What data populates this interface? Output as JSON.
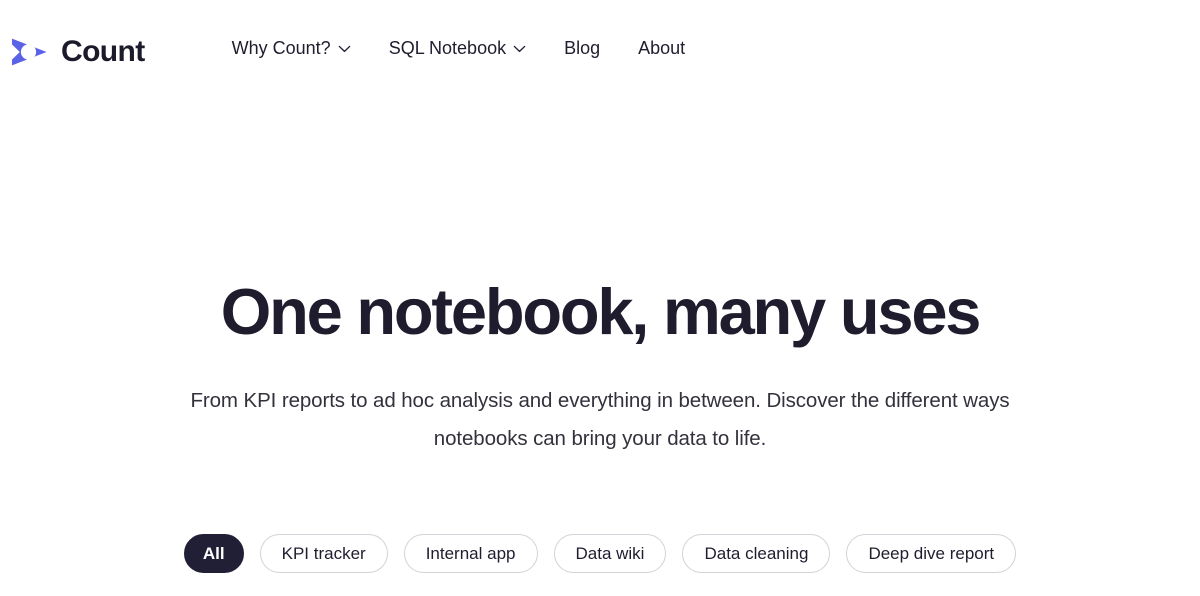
{
  "header": {
    "brand": {
      "name": "Count",
      "logo_icon": "count-triangle-logo-icon",
      "logo_color": "#5a62e8"
    },
    "nav": [
      {
        "label": "Why Count?",
        "has_dropdown": true,
        "icon": "chevron-down-icon"
      },
      {
        "label": "SQL Notebook",
        "has_dropdown": true,
        "icon": "chevron-down-icon"
      },
      {
        "label": "Blog",
        "has_dropdown": false,
        "icon": ""
      },
      {
        "label": "About",
        "has_dropdown": false,
        "icon": ""
      }
    ]
  },
  "hero": {
    "title": "One notebook, many uses",
    "subtitle": "From KPI reports to ad hoc analysis and everything in between. Discover the different ways notebooks can bring your data to life.",
    "title_color": "#1e1c2d",
    "subtitle_color": "#33323c"
  },
  "filters": {
    "active": "All",
    "active_bg": "#211f36",
    "inactive_border": "#d2d2d8",
    "items": [
      {
        "label": "All",
        "active": true
      },
      {
        "label": "KPI tracker",
        "active": false
      },
      {
        "label": "Internal app",
        "active": false
      },
      {
        "label": "Data wiki",
        "active": false
      },
      {
        "label": "Data cleaning",
        "active": false
      },
      {
        "label": "Deep dive report",
        "active": false
      }
    ]
  }
}
